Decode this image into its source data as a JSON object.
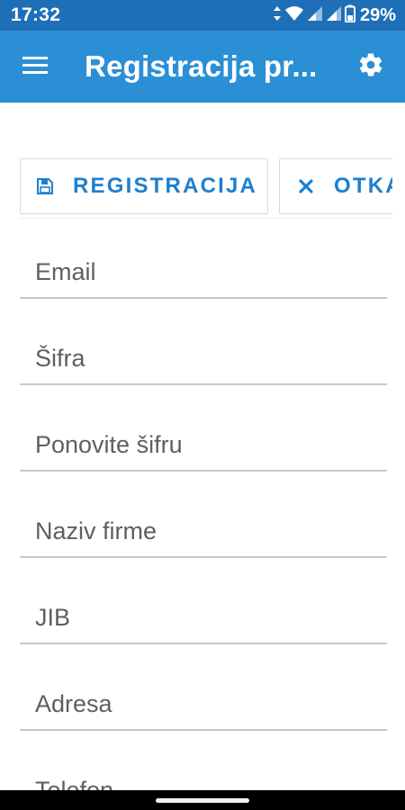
{
  "status_bar": {
    "time": "17:32",
    "battery_percent": "29%",
    "icons": [
      "data-arrows-icon",
      "wifi-icon",
      "signal-icon",
      "signal-icon",
      "battery-icon"
    ]
  },
  "app_bar": {
    "title": "Registracija pr...",
    "menu_icon": "menu-icon",
    "settings_icon": "gear-icon",
    "color": "#2b8fd6"
  },
  "actions": {
    "register_label": "REGISTRACIJA",
    "register_icon": "save-icon",
    "cancel_label": "OTKA",
    "cancel_icon": "close-icon",
    "accent": "#1d7fcf"
  },
  "form": {
    "fields": [
      {
        "placeholder": "Email",
        "value": ""
      },
      {
        "placeholder": "Šifra",
        "value": ""
      },
      {
        "placeholder": "Ponovite šifru",
        "value": ""
      },
      {
        "placeholder": "Naziv firme",
        "value": ""
      },
      {
        "placeholder": "JIB",
        "value": ""
      },
      {
        "placeholder": "Adresa",
        "value": ""
      },
      {
        "placeholder": "Telefon",
        "value": ""
      }
    ]
  }
}
